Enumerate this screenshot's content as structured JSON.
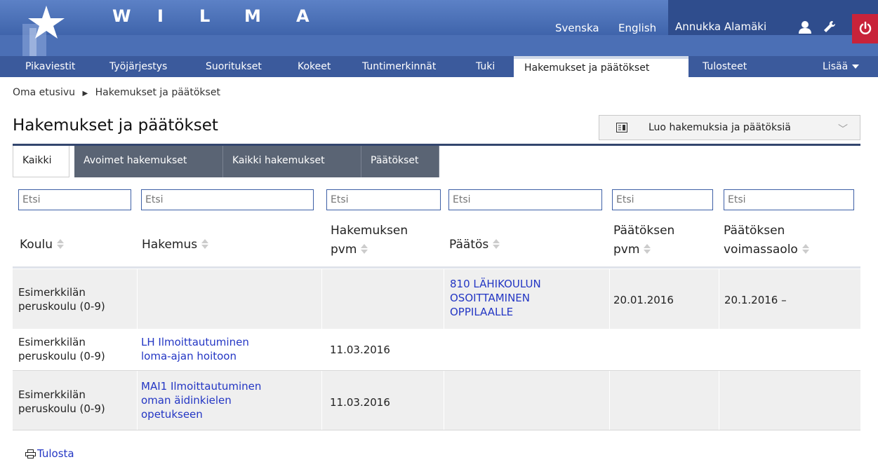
{
  "app": {
    "brand_letters": [
      "W",
      "I",
      "L",
      "M",
      "A"
    ],
    "languages": [
      "Svenska",
      "English"
    ],
    "user_name": "Annukka Alamäki",
    "icons": [
      "star-logo-icon",
      "user-icon",
      "wrench-icon",
      "power-icon"
    ]
  },
  "nav": {
    "items": [
      "Pikaviestit",
      "Työjärjestys",
      "Suoritukset",
      "Kokeet",
      "Tuntimerkinnät",
      "Tuki",
      "Hakemukset ja päätökset",
      "Tulosteet"
    ],
    "active": "Hakemukset ja päätökset",
    "more": "Lisää"
  },
  "breadcrumb": [
    "Oma etusivu",
    "Hakemukset ja päätökset"
  ],
  "page": {
    "title": "Hakemukset ja päätökset",
    "create_button": "Luo hakemuksia ja päätöksiä"
  },
  "tabs": {
    "items": [
      "Kaikki",
      "Avoimet hakemukset",
      "Kaikki hakemukset",
      "Päätökset"
    ],
    "active": "Kaikki"
  },
  "filters": {
    "placeholder": "Etsi"
  },
  "table": {
    "headers": [
      [
        "Koulu"
      ],
      [
        "Hakemus"
      ],
      [
        "Hakemuksen",
        "pvm"
      ],
      [
        "Päätös"
      ],
      [
        "Päätöksen",
        "pvm"
      ],
      [
        "Päätöksen",
        "voimassaolo"
      ]
    ],
    "rows": [
      {
        "koulu": [
          "Esimerkkilän",
          "peruskoulu (0-9)"
        ],
        "hakemus": [],
        "hakemus_pvm": "",
        "paatos": [
          "810 LÄHIKOULUN",
          "OSOITTAMINEN",
          "OPPILAALLE"
        ],
        "paatos_pvm": "20.01.2016",
        "voimassaolo": "20.1.2016 –"
      },
      {
        "koulu": [
          "Esimerkkilän",
          "peruskoulu (0-9)"
        ],
        "hakemus": [
          "LH Ilmoittautuminen",
          "loma-ajan hoitoon"
        ],
        "hakemus_pvm": "11.03.2016",
        "paatos": [],
        "paatos_pvm": "",
        "voimassaolo": ""
      },
      {
        "koulu": [
          "Esimerkkilän",
          "peruskoulu (0-9)"
        ],
        "hakemus": [
          "MAI1 Ilmoittautuminen",
          "oman äidinkielen",
          "opetukseen"
        ],
        "hakemus_pvm": "11.03.2016",
        "paatos": [],
        "paatos_pvm": "",
        "voimassaolo": ""
      }
    ]
  },
  "print_label": "Tulosta",
  "colors": {
    "header_blue": "#4b6fb5",
    "nav_blue": "#3b5a9c",
    "user_area": "#2f4d8d",
    "power_red": "#c8233a",
    "tab_gray": "#5a6474",
    "link_blue": "#2336c4"
  }
}
